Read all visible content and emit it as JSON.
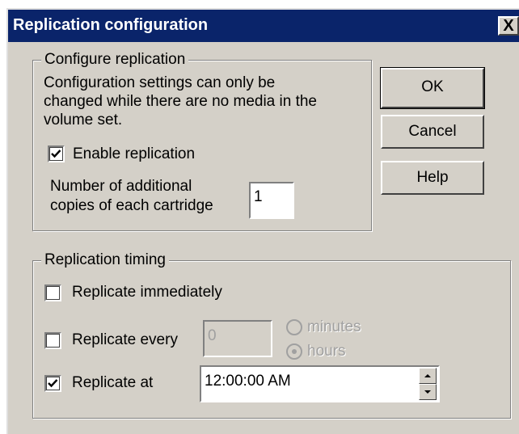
{
  "window": {
    "title": "Replication configuration",
    "close_glyph": "X"
  },
  "configure": {
    "legend": "Configure replication",
    "info_line1": "Configuration settings can only be",
    "info_line2": "changed while there are no media in the",
    "info_line3": "volume set.",
    "enable_label": "Enable replication",
    "enable_checked": true,
    "copies_label1": "Number of additional",
    "copies_label2": "copies of each cartridge",
    "copies_value": "1"
  },
  "buttons": {
    "ok": "OK",
    "cancel": "Cancel",
    "help": "Help"
  },
  "timing": {
    "legend": "Replication timing",
    "immediately_label": "Replicate immediately",
    "immediately_checked": false,
    "every_label": "Replicate every",
    "every_checked": false,
    "every_value": "0",
    "minutes_label": "minutes",
    "hours_label": "hours",
    "selected_unit": "hours",
    "at_label": "Replicate at",
    "at_checked": true,
    "at_value": "12:00:00 AM"
  },
  "icons": {
    "checkbox": "check-icon",
    "close": "close-icon",
    "spin_up": "arrow-up-icon",
    "spin_down": "arrow-down-icon"
  }
}
